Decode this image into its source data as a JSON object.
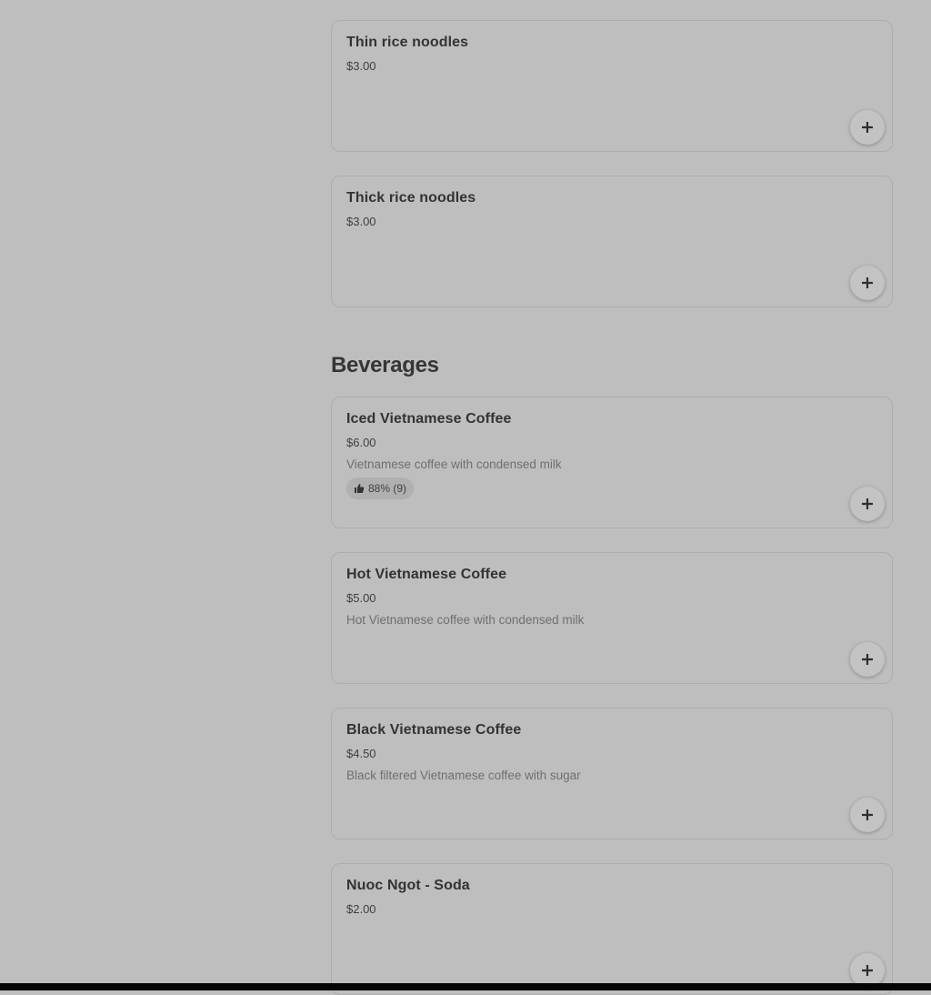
{
  "menu": {
    "items_top": [
      {
        "name": "Thin rice noodles",
        "price": "$3.00"
      },
      {
        "name": "Thick rice noodles",
        "price": "$3.00"
      }
    ],
    "beverages": {
      "title": "Beverages",
      "items": [
        {
          "name": "Iced Vietnamese Coffee",
          "price": "$6.00",
          "description": "Vietnamese coffee with condensed milk",
          "rating": "88% (9)"
        },
        {
          "name": "Hot Vietnamese Coffee",
          "price": "$5.00",
          "description": "Hot Vietnamese coffee with condensed milk"
        },
        {
          "name": "Black Vietnamese Coffee",
          "price": "$4.50",
          "description": "Black filtered Vietnamese coffee with sugar"
        },
        {
          "name": "Nuoc Ngot - Soda",
          "price": "$2.00"
        }
      ]
    }
  },
  "icons": {
    "add": "plus-icon",
    "rating": "thumbs-up-icon"
  },
  "colors": {
    "overlay_background": "#bebebe",
    "card_border": "#adadad",
    "text_primary": "#333333",
    "text_secondary": "#6f6f6f"
  }
}
